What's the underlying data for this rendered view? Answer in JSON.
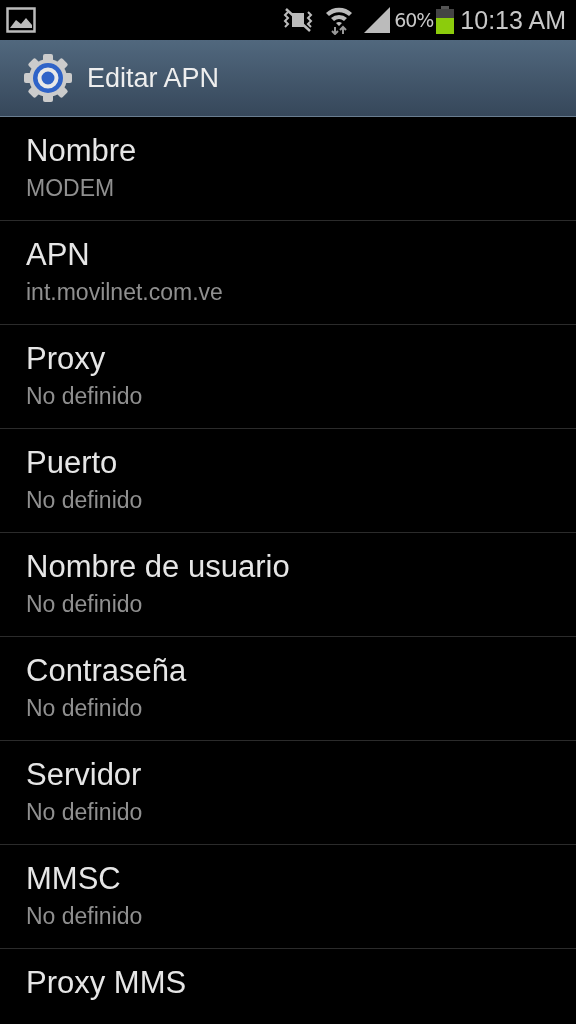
{
  "status_bar": {
    "battery": "60%",
    "time": "10:13 AM"
  },
  "header": {
    "title": "Editar APN"
  },
  "items": [
    {
      "title": "Nombre",
      "value": "MODEM"
    },
    {
      "title": "APN",
      "value": "int.movilnet.com.ve"
    },
    {
      "title": "Proxy",
      "value": "No definido"
    },
    {
      "title": "Puerto",
      "value": "No definido"
    },
    {
      "title": "Nombre de usuario",
      "value": "No definido"
    },
    {
      "title": "Contraseña",
      "value": "No definido"
    },
    {
      "title": "Servidor",
      "value": "No definido"
    },
    {
      "title": "MMSC",
      "value": "No definido"
    },
    {
      "title": "Proxy MMS"
    }
  ]
}
